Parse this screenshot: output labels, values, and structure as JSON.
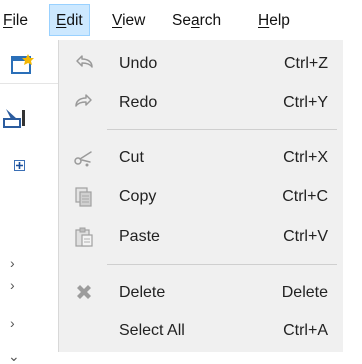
{
  "menubar": {
    "file": "File",
    "edit": "Edit",
    "view": "View",
    "search": "Search",
    "help": "Help"
  },
  "menu": {
    "items": [
      {
        "label": "Undo",
        "shortcut": "Ctrl+Z",
        "icon": "undo-icon"
      },
      {
        "label": "Redo",
        "shortcut": "Ctrl+Y",
        "icon": "redo-icon"
      },
      {
        "label": "Cut",
        "shortcut": "Ctrl+X",
        "icon": "scissors-icon"
      },
      {
        "label": "Copy",
        "shortcut": "Ctrl+C",
        "icon": "copy-icon"
      },
      {
        "label": "Paste",
        "shortcut": "Ctrl+V",
        "icon": "paste-icon"
      },
      {
        "label": "Delete",
        "shortcut": "Delete",
        "icon": "delete-icon"
      },
      {
        "label": "Select All",
        "shortcut": "Ctrl+A",
        "icon": ""
      }
    ]
  },
  "colors": {
    "menu_bg": "#f0f0f0",
    "active_menu_bg": "#cce8ff",
    "separator": "#cfcfcf"
  }
}
